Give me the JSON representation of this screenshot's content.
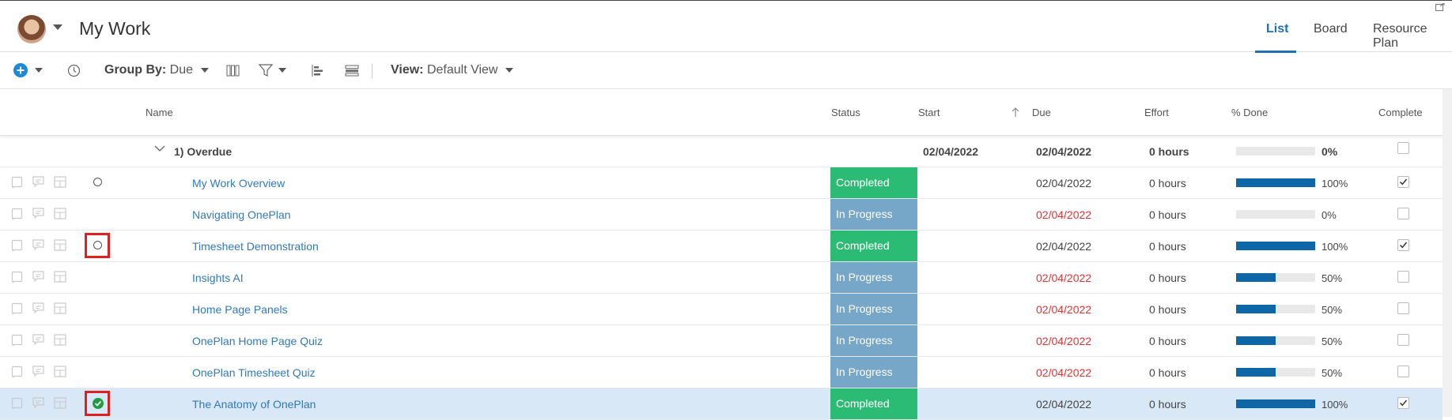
{
  "header": {
    "title": "My Work",
    "tabs": [
      {
        "label": "List",
        "active": true
      },
      {
        "label": "Board",
        "active": false
      },
      {
        "label": "Resource Plan",
        "active": false
      }
    ]
  },
  "toolbar": {
    "group_by_label": "Group By:",
    "group_by_value": "Due",
    "view_label": "View:",
    "view_value": "Default View"
  },
  "columns": {
    "name": "Name",
    "status": "Status",
    "start": "Start",
    "due": "Due",
    "effort": "Effort",
    "percent_done": "% Done",
    "complete": "Complete"
  },
  "group": {
    "title": "1) Overdue",
    "start": "02/04/2022",
    "due": "02/04/2022",
    "effort": "0 hours",
    "percent": "0%",
    "percent_value": 0
  },
  "rows": [
    {
      "name": "My Work Overview",
      "status": "Completed",
      "due": "02/04/2022",
      "overdue": false,
      "effort": "0 hours",
      "percent": "100%",
      "percent_value": 100,
      "complete": true,
      "marker": "radio"
    },
    {
      "name": "Navigating OnePlan",
      "status": "In Progress",
      "due": "02/04/2022",
      "overdue": true,
      "effort": "0 hours",
      "percent": "0%",
      "percent_value": 0,
      "complete": false,
      "marker": "none"
    },
    {
      "name": "Timesheet Demonstration",
      "status": "Completed",
      "due": "02/04/2022",
      "overdue": false,
      "effort": "0 hours",
      "percent": "100%",
      "percent_value": 100,
      "complete": true,
      "marker": "radio-highlight"
    },
    {
      "name": "Insights AI",
      "status": "In Progress",
      "due": "02/04/2022",
      "overdue": true,
      "effort": "0 hours",
      "percent": "50%",
      "percent_value": 50,
      "complete": false,
      "marker": "none"
    },
    {
      "name": "Home Page Panels",
      "status": "In Progress",
      "due": "02/04/2022",
      "overdue": true,
      "effort": "0 hours",
      "percent": "50%",
      "percent_value": 50,
      "complete": false,
      "marker": "none"
    },
    {
      "name": "OnePlan Home Page Quiz",
      "status": "In Progress",
      "due": "02/04/2022",
      "overdue": true,
      "effort": "0 hours",
      "percent": "50%",
      "percent_value": 50,
      "complete": false,
      "marker": "none"
    },
    {
      "name": "OnePlan Timesheet Quiz",
      "status": "In Progress",
      "due": "02/04/2022",
      "overdue": true,
      "effort": "0 hours",
      "percent": "50%",
      "percent_value": 50,
      "complete": false,
      "marker": "none"
    },
    {
      "name": "The Anatomy of OnePlan",
      "status": "Completed",
      "due": "02/04/2022",
      "overdue": false,
      "effort": "0 hours",
      "percent": "100%",
      "percent_value": 100,
      "complete": true,
      "marker": "done-highlight",
      "selected": true
    }
  ],
  "colors": {
    "accent": "#1f6fb2",
    "completed": "#2bbb74",
    "in_progress": "#76a6c8",
    "overdue_text": "#e03434",
    "progress_fill": "#0f66a6"
  }
}
